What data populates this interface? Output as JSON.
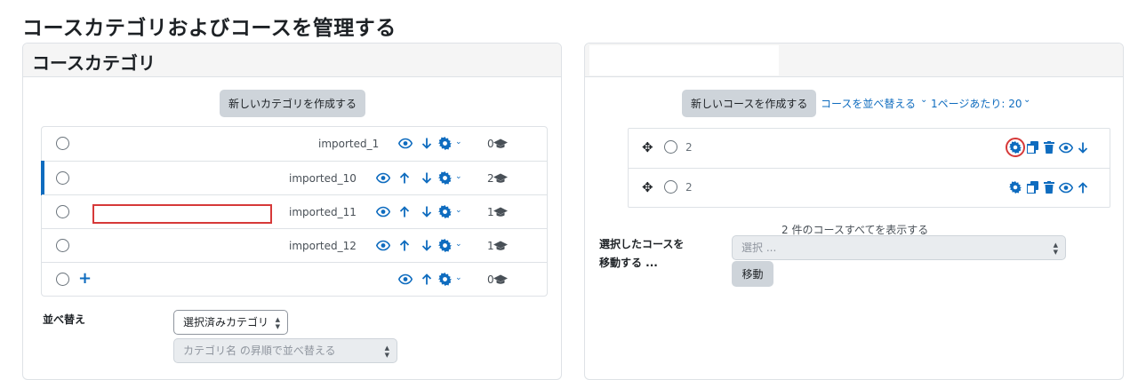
{
  "page": {
    "title": "コースカテゴリおよびコースを管理する"
  },
  "categories_panel": {
    "title": "コースカテゴリ",
    "create_button": "新しいカテゴリを作成する",
    "rows": [
      {
        "name": "imported_1",
        "count": "0"
      },
      {
        "name": "imported_10",
        "count": "2"
      },
      {
        "name": "imported_11",
        "count": "1"
      },
      {
        "name": "imported_12",
        "count": "1"
      },
      {
        "name": "",
        "count": "0"
      }
    ],
    "sort_label": "並べ替え",
    "sort_select": "選択済みカテゴリ",
    "sort_by_select": "カテゴリ名 の昇順で並べ替える"
  },
  "courses_panel": {
    "create_button": "新しいコースを作成する",
    "sort_link": "コースを並べ替える",
    "per_page": "1ページあたり: 20",
    "rows": [
      {
        "prefix": "2"
      },
      {
        "prefix": "2"
      }
    ],
    "show_all": "2 件のコースすべてを表示する",
    "move_label_1": "選択したコースを",
    "move_label_2": "移動する ...",
    "move_select": "選択 ...",
    "move_button": "移動"
  },
  "colors": {
    "accent": "#0f6cbf",
    "highlight": "#d63939"
  }
}
